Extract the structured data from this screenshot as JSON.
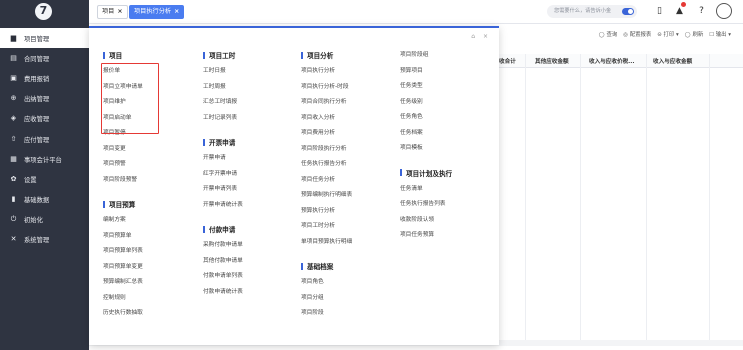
{
  "sidebar": {
    "items": [
      {
        "label": "项目管理",
        "icon": "folder-icon",
        "glyph": "▆",
        "active": true
      },
      {
        "label": "合同管理",
        "icon": "document-icon",
        "glyph": "▤"
      },
      {
        "label": "费用报销",
        "icon": "receipt-icon",
        "glyph": "▣"
      },
      {
        "label": "出纳管理",
        "icon": "cashier-icon",
        "glyph": "⊕"
      },
      {
        "label": "应收管理",
        "icon": "receivable-icon",
        "glyph": "◈"
      },
      {
        "label": "应付管理",
        "icon": "payable-icon",
        "glyph": "⇧"
      },
      {
        "label": "事项会计平台",
        "icon": "grid-icon",
        "glyph": "▦"
      },
      {
        "label": "设置",
        "icon": "gear-icon",
        "glyph": "✿"
      },
      {
        "label": "基础数据",
        "icon": "bar-chart-icon",
        "glyph": "▮"
      },
      {
        "label": "初始化",
        "icon": "power-icon",
        "glyph": "⏻"
      },
      {
        "label": "系统管理",
        "icon": "tools-icon",
        "glyph": "✕"
      }
    ]
  },
  "tabs": [
    {
      "label": "项目",
      "close": "×"
    },
    {
      "label": "项目执行分析",
      "close": "×",
      "active": true
    }
  ],
  "topbar": {
    "search_placeholder": "您需要什么，请告诉小金"
  },
  "toolbar": {
    "items": [
      "◯ 查询",
      "◎ 配置报表",
      "⊝ 打印 ▾",
      "◯ 刷新",
      "☐ 输出 ▾"
    ]
  },
  "grid": {
    "headers": [
      "收合计",
      "其他应收金额",
      "收入与应收价税...",
      "收入与应收金额"
    ]
  },
  "menu": {
    "close_icons": "⌂ ×",
    "columns": [
      {
        "sections": [
          {
            "title": "项目",
            "items": [
              "报价单",
              "项目立项申请单",
              "项目维护",
              "项目启动单",
              "项目暂停",
              "项目变更",
              "项目预警",
              "项目阶段预警"
            ]
          },
          {
            "title": "项目预算",
            "items": [
              "编制方案",
              "项目预算单",
              "项目预算单列表",
              "项目预算单变更",
              "预算编制汇总表",
              "控制规则",
              "历史执行数抽取"
            ]
          }
        ]
      },
      {
        "sections": [
          {
            "title": "项目工时",
            "items": [
              "工时日报",
              "工时周报",
              "汇总工时填报",
              "工时记录列表"
            ]
          },
          {
            "title": "开票申请",
            "items": [
              "开票申请",
              "红字开票申请",
              "开票申请列表",
              "开票申请统计表"
            ]
          },
          {
            "title": "付款申请",
            "items": [
              "采购付款申请单",
              "其他付款申请单",
              "付款申请单列表",
              "付款申请统计表"
            ]
          }
        ]
      },
      {
        "sections": [
          {
            "title": "项目分析",
            "items": [
              "项目执行分析",
              "项目执行分析-时段",
              "项目合同执行分析",
              "项目收入分析",
              "项目费用分析",
              "项目阶段执行分析",
              "任务执行报告分析",
              "项目任务分析",
              "预算编制执行明细表",
              "预算执行分析",
              "项目工时分析",
              "单项目预算执行明细"
            ]
          },
          {
            "title": "基础档案",
            "items": [
              "项目角色",
              "项目分组",
              "项目阶段"
            ]
          }
        ]
      },
      {
        "sections": [
          {
            "title": "",
            "items": [
              "项目阶段组",
              "预算项目",
              "任务类型",
              "任务级别",
              "任务角色",
              "任务档案",
              "项目模板"
            ]
          },
          {
            "title": "项目计划及执行",
            "items": [
              "任务清单",
              "任务执行报告列表",
              "收款阶段认领",
              "项目任务预算"
            ]
          }
        ]
      }
    ]
  },
  "colors": {
    "sidebar_bg": "#2f3441",
    "accent": "#3a64d8",
    "highlight_box": "#e53935"
  }
}
